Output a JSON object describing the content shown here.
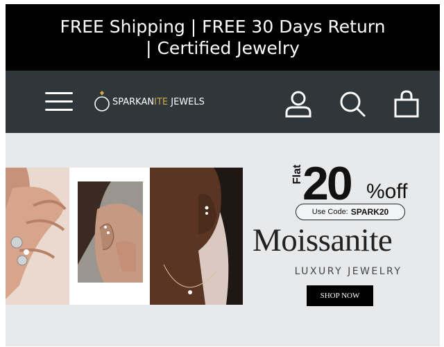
{
  "announcement": {
    "text": "FREE Shipping | FREE 30 Days Return | Certified Jewelry"
  },
  "header": {
    "logo_part1": "SPARKAN",
    "logo_part2": "ITE",
    "logo_part3": " JEWELS",
    "icons": [
      "menu-icon",
      "ring-logo-icon",
      "account-icon",
      "search-icon",
      "shopping-bag-icon"
    ],
    "colors": {
      "nav_bg": "#2f373b",
      "logo_gold": "#d4a84a"
    }
  },
  "banner": {
    "flat": "Flat",
    "discount": "20",
    "off": "%off",
    "code_label": "Use Code:",
    "code": "SPARK20",
    "headline": "Moissanite",
    "subhead": "LUXURY JEWELRY",
    "cta": "SHOP NOW"
  },
  "colors": {
    "announcement_bg": "#000000",
    "hero_bg": "#e8e9eb",
    "cta_bg": "#000000"
  }
}
